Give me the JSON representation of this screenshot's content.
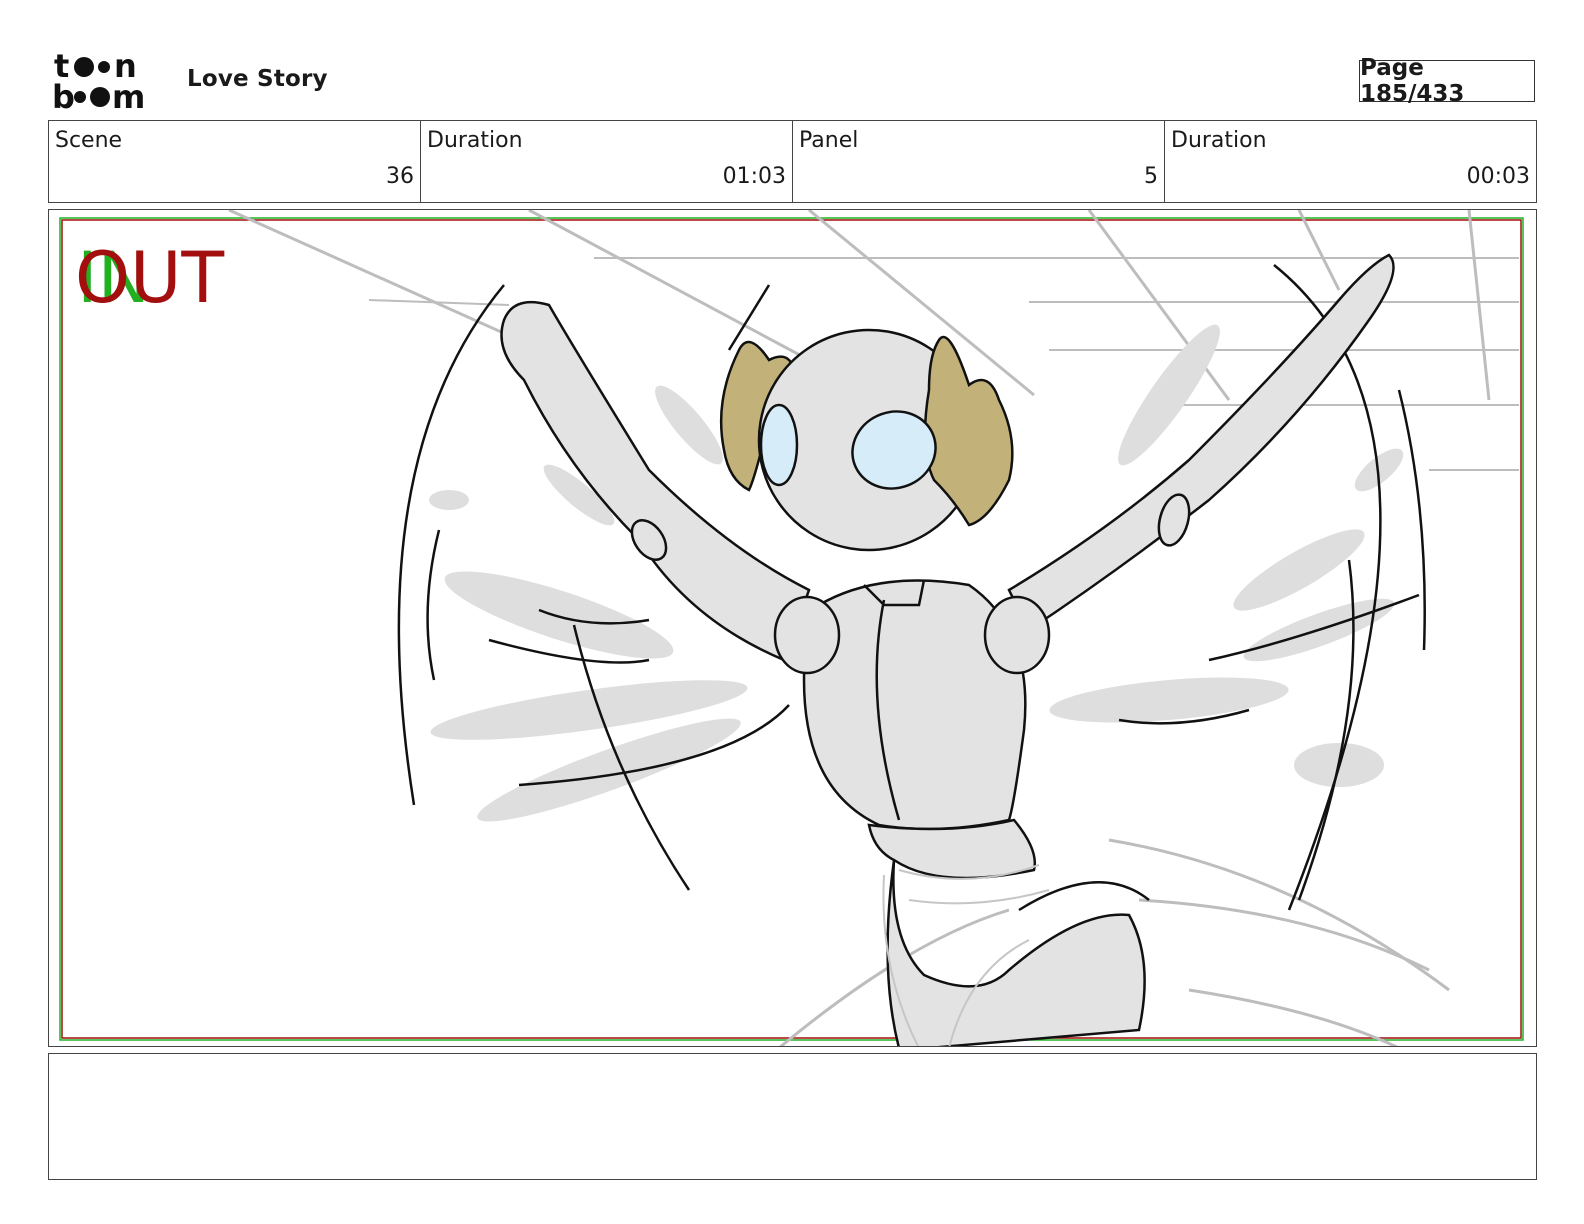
{
  "header": {
    "logo_text": "toon boom",
    "project_title": "Love Story",
    "page_indicator": "Page 185/433"
  },
  "info": {
    "scene_label": "Scene",
    "scene_value": "36",
    "scene_duration_label": "Duration",
    "scene_duration_value": "01:03",
    "panel_label": "Panel",
    "panel_value": "5",
    "panel_duration_label": "Duration",
    "panel_duration_value": "00:03"
  },
  "panel": {
    "in_marker": "IN",
    "out_marker": "OUT",
    "in_color": "#22b022",
    "out_color": "#a30f0f",
    "character_eye_color": "#d6ecf8",
    "character_hair_color": "#c2b27a",
    "character_body_color": "#e3e3e3"
  },
  "notes": {
    "text": ""
  }
}
